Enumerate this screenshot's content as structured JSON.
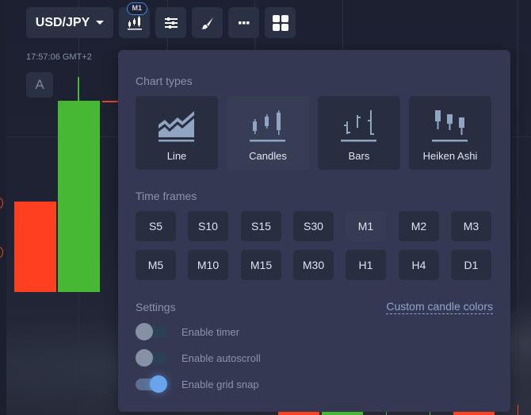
{
  "toolbar": {
    "pair_label": "USD/JPY",
    "timeframe_badge": "M1",
    "buttons": [
      {
        "name": "chart-type-button",
        "icon": "candlestick-icon"
      },
      {
        "name": "indicators-button",
        "icon": "sliders-icon"
      },
      {
        "name": "drawing-button",
        "icon": "brush-icon"
      },
      {
        "name": "more-button",
        "icon": "dots-icon"
      },
      {
        "name": "layout-button",
        "icon": "grid-icon"
      }
    ]
  },
  "chart": {
    "time_label": "17:57:06 GMT+2",
    "auto_button_label": "A",
    "colors": {
      "up": "#46b833",
      "down": "#ff3f1f",
      "accent": "#3a8be0"
    }
  },
  "panel": {
    "chart_types_title": "Chart types",
    "chart_types": [
      {
        "label": "Line",
        "icon": "line-chart-icon",
        "active": false
      },
      {
        "label": "Candles",
        "icon": "candles-icon",
        "active": true
      },
      {
        "label": "Bars",
        "icon": "bars-icon",
        "active": false
      },
      {
        "label": "Heiken Ashi",
        "icon": "heiken-ashi-icon",
        "active": false
      }
    ],
    "time_frames_title": "Time frames",
    "time_frames": [
      "S5",
      "S10",
      "S15",
      "S30",
      "M1",
      "M2",
      "M3",
      "M5",
      "M10",
      "M15",
      "M30",
      "H1",
      "H4",
      "D1"
    ],
    "selected_time_frame": "M1",
    "settings_title": "Settings",
    "custom_colors_link": "Custom candle colors",
    "settings": [
      {
        "label": "Enable timer",
        "enabled": false
      },
      {
        "label": "Enable autoscroll",
        "enabled": false
      },
      {
        "label": "Enable grid snap",
        "enabled": true
      }
    ]
  }
}
